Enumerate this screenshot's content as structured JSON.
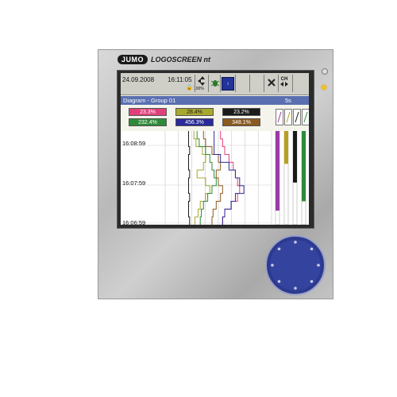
{
  "brand": {
    "logo": "JUMO",
    "name": "LOGOSCREEN nt"
  },
  "toolbar": {
    "date": "24.09.2008",
    "time": "16:11:05",
    "memory": "100%",
    "ch_label": "CH"
  },
  "diagram": {
    "title": "Diagram - Group 01",
    "interval": "5s"
  },
  "values": [
    {
      "text": "23.3%",
      "color": "#e0407a"
    },
    {
      "text": "28.4%",
      "color": "#a8a830"
    },
    {
      "text": "23.2%",
      "color": "#1a1a1a"
    },
    {
      "text": "232.4%",
      "color": "#2e8a3a"
    },
    {
      "text": "456.3%",
      "color": "#2a2a9a"
    },
    {
      "text": "348.1%",
      "color": "#8a5a20"
    }
  ],
  "chart_data": {
    "type": "line",
    "time_labels": [
      "16:08:59",
      "16:07:59",
      "16:06:59"
    ],
    "series": [
      {
        "color": "#1a1a1a",
        "values": [
          22,
          22,
          23,
          22,
          22,
          23,
          22,
          22,
          23,
          22,
          22,
          23
        ]
      },
      {
        "color": "#a8a830",
        "values": [
          27,
          29,
          35,
          38,
          36,
          30,
          38,
          42,
          38,
          33,
          31,
          28
        ]
      },
      {
        "color": "#2e8a3a",
        "values": [
          30,
          32,
          38,
          42,
          44,
          46,
          48,
          44,
          40,
          36,
          34,
          33
        ]
      },
      {
        "color": "#8a5a20",
        "values": [
          36,
          38,
          44,
          50,
          52,
          48,
          50,
          54,
          52,
          48,
          45,
          44
        ]
      },
      {
        "color": "#e0407a",
        "values": [
          52,
          54,
          56,
          60,
          64,
          66,
          68,
          70,
          68,
          62,
          56,
          54
        ]
      },
      {
        "color": "#2a2a9a",
        "values": [
          46,
          46,
          46,
          52,
          60,
          66,
          70,
          74,
          66,
          62,
          56,
          54
        ]
      }
    ],
    "bars": [
      {
        "color": "#9a3aa8",
        "value": 0.85
      },
      {
        "color": "#b8a020",
        "value": 0.35
      },
      {
        "color": "#1a1a1a",
        "value": 0.55
      },
      {
        "color": "#2e8a3a",
        "value": 0.75
      }
    ]
  },
  "icons": {
    "knob": "navigation-knob-icon"
  }
}
